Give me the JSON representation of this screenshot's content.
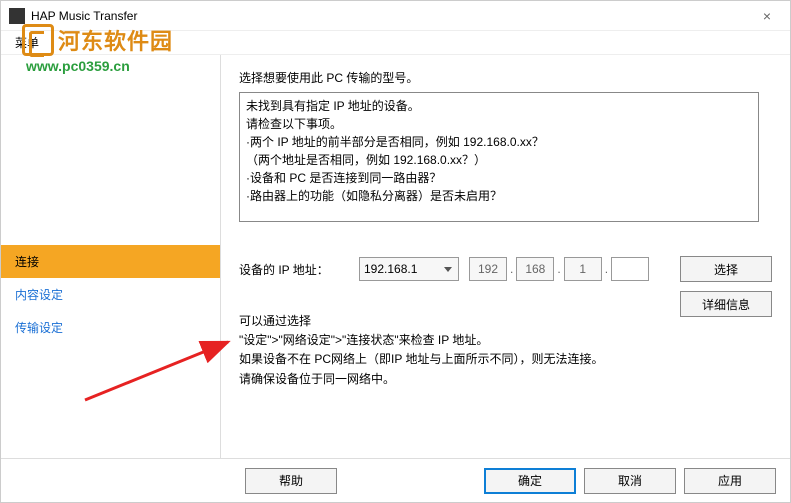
{
  "window": {
    "title": "HAP Music Transfer",
    "menu": "菜单"
  },
  "watermark": {
    "text": "河东软件园",
    "url": "www.pc0359.cn"
  },
  "sidebar": {
    "items": [
      {
        "label": "连接",
        "active": true
      },
      {
        "label": "内容设定",
        "active": false
      },
      {
        "label": "传输设定",
        "active": false
      }
    ]
  },
  "main": {
    "section_label": "选择想要使用此 PC 传输的型号。",
    "message_lines": [
      "未找到具有指定 IP 地址的设备。",
      "请检查以下事项。",
      "·两个 IP 地址的前半部分是否相同，例如 192.168.0.xx？",
      "（两个地址是否相同，例如 192.168.0.xx？）",
      "·设备和 PC 是否连接到同一路由器？",
      "·路由器上的功能（如隐私分离器）是否未启用？"
    ],
    "ip_label": "设备的 IP 地址：",
    "ip_combo": "192.168.1",
    "ip_oct1": "192",
    "ip_oct2": "168",
    "ip_oct3": "1",
    "ip_oct4": "",
    "select_btn": "选择",
    "detail_btn": "详细信息",
    "help_lines": [
      "可以通过选择",
      "\"设定\">\"网络设定\">\"连接状态\"来检查 IP 地址。",
      "如果设备不在 PC网络上（即IP 地址与上面所示不同），则无法连接。",
      "请确保设备位于同一网络中。"
    ]
  },
  "footer": {
    "help": "帮助",
    "ok": "确定",
    "cancel": "取消",
    "apply": "应用"
  }
}
